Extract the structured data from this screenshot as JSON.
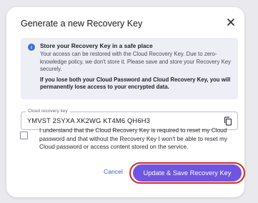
{
  "dialog": {
    "title": "Generate a new Recovery Key",
    "close_icon": "close-icon"
  },
  "info": {
    "icon": "info-icon",
    "heading": "Store your Recovery Key in a safe place",
    "body": "Your access can be restored with the Cloud Recovery Key. Due to zero-knowledge policy, we don't store it. Please save and store your Recovery Key securely.",
    "warning": "If you lose both your Cloud Password and Cloud Recovery Key, you will permanently lose access to your encrypted data."
  },
  "key_field": {
    "label": "Cloud recovery key",
    "value": "YMVST 2SYXA XK2WG KT4M6 QH6H3",
    "copy_icon": "copy-icon"
  },
  "consent": {
    "checked": false,
    "text": "I understand that the Cloud Recovery Key is required to reset my Cloud password and that without the Recovery Key I won't be able to reset my Cloud password or access content stored on the service."
  },
  "actions": {
    "cancel_label": "Cancel",
    "primary_label": "Update & Save Recovery Key"
  },
  "colors": {
    "primary": "#6f55e0",
    "highlight_ring": "#d6262b",
    "link": "#3c57c4",
    "info_background": "#eeeef6",
    "info_icon": "#3f6fd1"
  }
}
